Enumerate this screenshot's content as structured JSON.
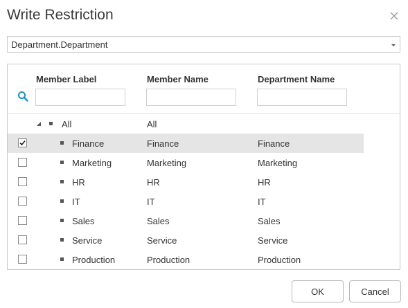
{
  "dialog": {
    "title": "Write Restriction",
    "close_icon": "close-icon"
  },
  "dimension_select": {
    "value": "Department.Department",
    "icon": "dropdown-caret-icon"
  },
  "grid": {
    "columns": [
      "Member Label",
      "Member Name",
      "Department Name"
    ],
    "filter_icon": "search-icon",
    "root": {
      "label": "All",
      "name": "All",
      "expanded": true
    },
    "rows": [
      {
        "label": "Finance",
        "name": "Finance",
        "department": "Finance",
        "checked": true
      },
      {
        "label": "Marketing",
        "name": "Marketing",
        "department": "Marketing",
        "checked": false
      },
      {
        "label": "HR",
        "name": "HR",
        "department": "HR",
        "checked": false
      },
      {
        "label": "IT",
        "name": "IT",
        "department": "IT",
        "checked": false
      },
      {
        "label": "Sales",
        "name": "Sales",
        "department": "Sales",
        "checked": false
      },
      {
        "label": "Service",
        "name": "Service",
        "department": "Service",
        "checked": false
      },
      {
        "label": "Production",
        "name": "Production",
        "department": "Production",
        "checked": false
      }
    ]
  },
  "buttons": {
    "ok": "OK",
    "cancel": "Cancel"
  },
  "colors": {
    "selected_row": "#e5e5e5",
    "search_icon": "#1a8fc9",
    "border": "#c8c8c8"
  }
}
